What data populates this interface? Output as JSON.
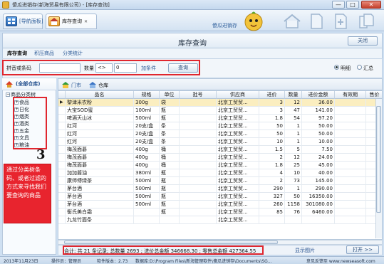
{
  "window": {
    "title": "傻瓜进销存(新海贸易有限公司) - [库存查询]",
    "minimize": "—",
    "maximize": "□",
    "close": "✕"
  },
  "toolbar": {
    "tabs": [
      {
        "label": "[导航面板]",
        "icon": "navigation-panel-icon"
      },
      {
        "label": "库存查询",
        "icon": "warehouse-icon",
        "close": "✕"
      }
    ],
    "brand": "傻瓜进销存",
    "nav_icons": [
      "home-icon",
      "document-icon",
      "add-document-icon",
      "copy-document-icon"
    ]
  },
  "page": {
    "title": "库存查询",
    "close_label": "关闭"
  },
  "subtabs": [
    "库存查询",
    "积压商品",
    "分类统计"
  ],
  "filter": {
    "name_label": "拼音或条码",
    "qty_label": "数量",
    "op": "<>",
    "qty_value": "0",
    "cond_label": "加条件",
    "query_label": "查询",
    "radio_detail": "明细",
    "radio_summary": "汇总"
  },
  "warehouses": {
    "all": "(全部仓库)",
    "tabs": [
      "门市",
      "仓库"
    ]
  },
  "tree": {
    "root": "商品分类树",
    "items": [
      "食品",
      "日化",
      "烟类",
      "酒类",
      "五金",
      "文具",
      "粮油"
    ]
  },
  "annotation": {
    "number": "3",
    "text": "通过分类树条码、或者过滤的方式来寻找我们要查询的商品"
  },
  "table": {
    "columns": [
      "品名",
      "规格",
      "单位",
      "批号",
      "供应商",
      "进价",
      "数量",
      "进价金额",
      "有效期",
      "售价"
    ],
    "rows": [
      [
        "黎津米农粉",
        "300g",
        "袋",
        "",
        "北京工贸贸...",
        "3",
        "12",
        "36.00",
        "",
        ""
      ],
      [
        "大宝SOD蜜",
        "100ml",
        "瓶",
        "",
        "北京工贸贸...",
        "3",
        "47",
        "141.00",
        "",
        ""
      ],
      [
        "啤酒天山冰",
        "500ml",
        "瓶",
        "",
        "北京工贸贸...",
        "1.8",
        "54",
        "97.20",
        "",
        ""
      ],
      [
        "红河",
        "20支/盒",
        "条",
        "",
        "北京工贸贸...",
        "50",
        "1",
        "50.00",
        "",
        ""
      ],
      [
        "红河",
        "20支/盒",
        "条",
        "",
        "北京工贸贸...",
        "50",
        "1",
        "50.00",
        "",
        ""
      ],
      [
        "红河",
        "20支/盒",
        "条",
        "",
        "北京工贸贸...",
        "10",
        "1",
        "10.00",
        "",
        ""
      ],
      [
        "梅茂面碁",
        "400g",
        "桶",
        "",
        "北京工贸贸...",
        "1.5",
        "5",
        "7.50",
        "",
        ""
      ],
      [
        "梅茂面碁",
        "400g",
        "桶",
        "",
        "北京工贸贸...",
        "2",
        "12",
        "24.00",
        "",
        ""
      ],
      [
        "梅茂面碁",
        "400g",
        "桶",
        "",
        "北京工贸贸...",
        "1.8",
        "25",
        "45.00",
        "",
        ""
      ],
      [
        "加加酱油",
        "380ml",
        "瓶",
        "",
        "北京工贸贸...",
        "4",
        "10",
        "40.00",
        "",
        ""
      ],
      [
        "康师傅绿茶",
        "500ml",
        "瓶",
        "",
        "北京工贸贸...",
        "2",
        "73",
        "145.00",
        "",
        ""
      ],
      [
        "茅台酒",
        "500ml",
        "瓶",
        "",
        "北京工贸贸...",
        "290",
        "1",
        "290.00",
        "",
        ""
      ],
      [
        "茅台酒",
        "500ml",
        "瓶",
        "",
        "北京工贸贸...",
        "327",
        "50",
        "16350.00",
        "",
        ""
      ],
      [
        "茅台酒",
        "500ml",
        "瓶",
        "",
        "北京工贸贸...",
        "260",
        "1158",
        "301080.00",
        "",
        ""
      ],
      [
        "衡氏美白霜",
        "",
        "瓶",
        "",
        "北京工贸贸...",
        "85",
        "76",
        "6460.00",
        "",
        ""
      ],
      [
        "九龙竹面条",
        "",
        "",
        "",
        "北京工贸贸...",
        "",
        "",
        "",
        "",
        ""
      ]
    ]
  },
  "totals": {
    "text": "合计: 共 21 条记录; 总数量 2693 ; 进价总金额 346668.30 ; 零售总金额 427364.55",
    "sum_link": "显示图片",
    "open_label": "打开 >>"
  },
  "status": {
    "date": "2013年11月23日",
    "operator": "操作员：管理员",
    "version": "软件版本：2.73",
    "db": "数据库:D:\\Program Files\\新海管理软件\\傻瓜进销存\\Documents\\SG...",
    "feedback": "意见反馈至 www.newseasoft.com"
  },
  "colors": {
    "accent_red": "#e0262e",
    "selected_row": "#fbeec0",
    "brand_blue": "#2f5f9b"
  }
}
